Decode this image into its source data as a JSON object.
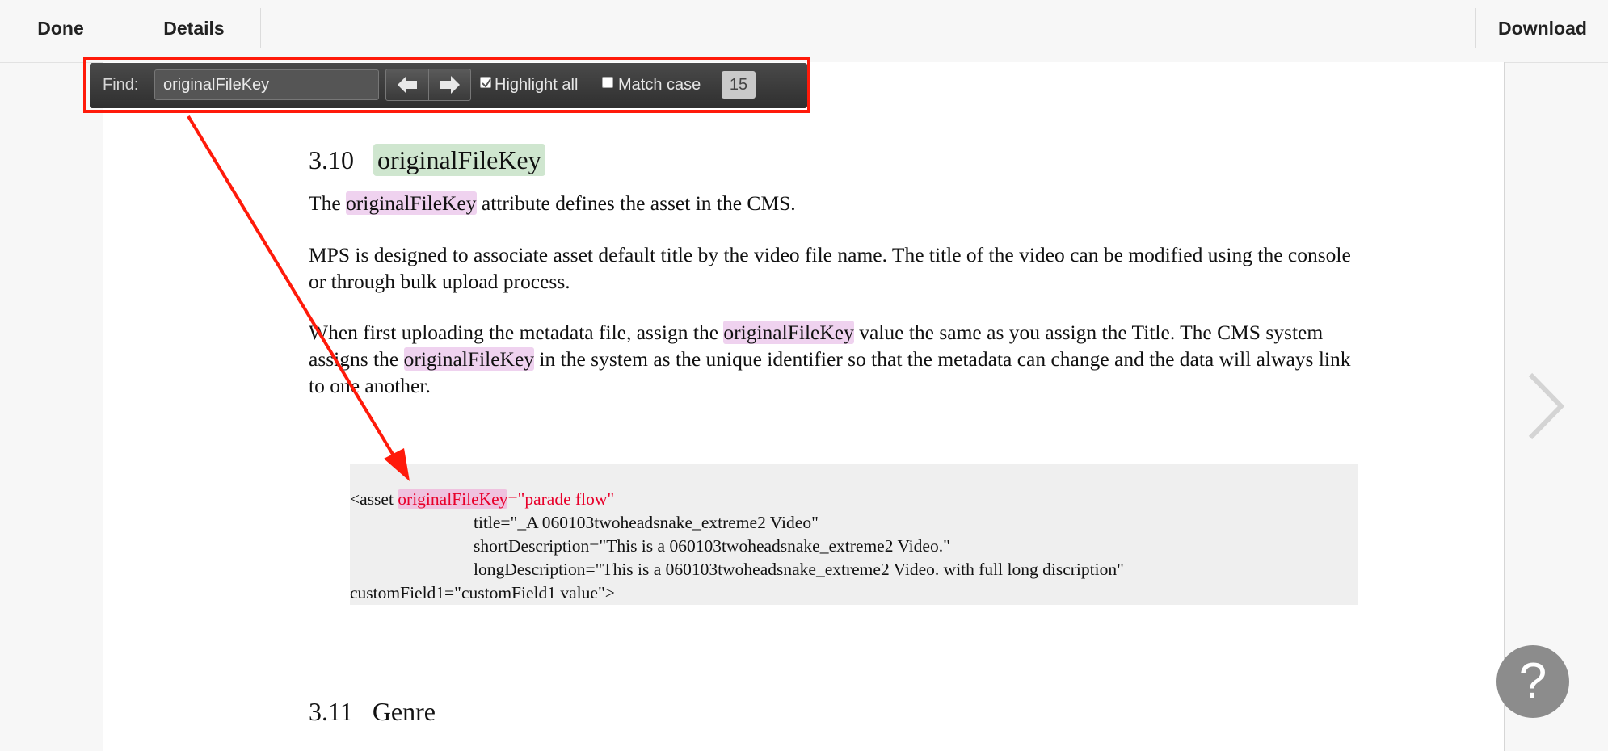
{
  "toolbar": {
    "done_label": "Done",
    "details_label": "Details",
    "download_label": "Download"
  },
  "find_bar": {
    "label": "Find:",
    "query": "originalFileKey",
    "prev_icon": "arrow-left-icon",
    "next_icon": "arrow-right-icon",
    "highlight_all_label": "Highlight all",
    "highlight_all_checked": true,
    "match_case_label": "Match case",
    "match_case_checked": false,
    "match_count": "15"
  },
  "document": {
    "section_310": {
      "number": "3.10",
      "title": "originalFileKey"
    },
    "p1": {
      "pre": "The ",
      "key": "originalFileKey",
      "post": " attribute defines the asset in the CMS."
    },
    "p2": "MPS is designed to associate asset default title by the video file name. The title of the video can be modified using the console or through bulk upload process.",
    "p3": {
      "a": "When first uploading the metadata file, assign the ",
      "key1": "originalFileKey",
      "b": " value the same as you assign the Title. The CMS system assigns the ",
      "key2": "originalFileKey",
      "c": " in the system as the unique identifier so that the metadata can change and the data will always link to one another."
    },
    "code": {
      "line1_pre": "<asset ",
      "line1_key": "originalFileKey",
      "line1_value": "=\"parade flow\"",
      "line2": "title=\"_A 060103twoheadsnake_extreme2 Video\"",
      "line3": "shortDescription=\"This is a 060103twoheadsnake_extreme2 Video.\"",
      "line4": "longDescription=\"This is a 060103twoheadsnake_extreme2 Video. with full long discription\"",
      "line5": "customField1=\"customField1 value\">"
    },
    "section_311": {
      "number": "3.11",
      "title": "Genre"
    }
  },
  "overlays": {
    "next_page_icon": "chevron-right-icon",
    "help_label": "?"
  },
  "colors": {
    "find_highlight": "#efd2ef",
    "current_match": "#cfe6cf",
    "annotation_red": "#ff1a0a",
    "code_string_red": "#e8002a"
  }
}
